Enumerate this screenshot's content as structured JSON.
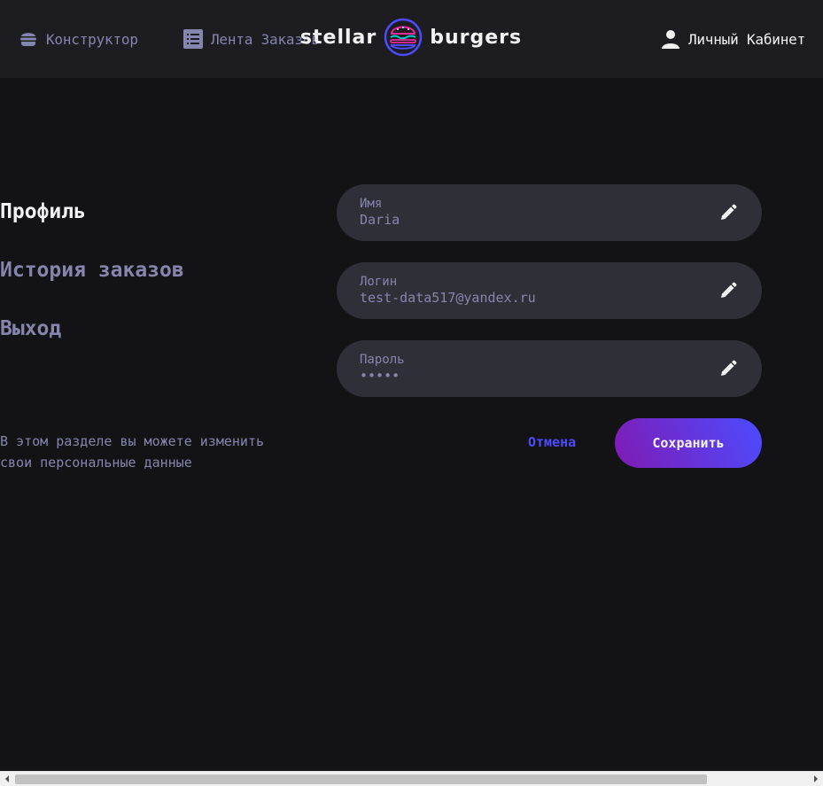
{
  "header": {
    "nav": {
      "constructor": "Конструктор",
      "feed": "Лента Заказов",
      "account": "Личный Кабинет"
    },
    "logo": {
      "left": "stellar",
      "right": "burgers"
    }
  },
  "sidebar": {
    "profile": "Профиль",
    "history": "История заказов",
    "logout": "Выход",
    "hint": "В этом разделе вы можете изменить свои персональные данные"
  },
  "form": {
    "name": {
      "label": "Имя",
      "value": "Daria"
    },
    "login": {
      "label": "Логин",
      "value": "test-data517@yandex.ru"
    },
    "password": {
      "label": "Пароль",
      "value": "•••••"
    },
    "cancel": "Отмена",
    "save": "Сохранить"
  },
  "colors": {
    "background": "#131316",
    "header": "#1C1C21",
    "field": "#2F2F37",
    "muted_text": "#8585AD",
    "accent": "#4C4CFF",
    "accent_purple": "#801AB3"
  },
  "icons": {
    "constructor": "burger-icon",
    "feed": "list-icon",
    "account": "profile-icon",
    "edit": "edit-pencil-icon"
  }
}
